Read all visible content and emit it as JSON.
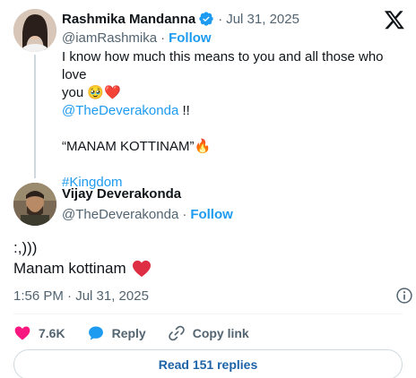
{
  "quoted_tweet": {
    "display_name": "Rashmika Mandanna",
    "handle": "@iamRashmika",
    "follow_label": "Follow",
    "date": "Jul 31, 2025",
    "separator": "·",
    "text_line1": "I know how much this means to you and all those who love",
    "text_line2": "you",
    "emoji_1": "🥹",
    "emoji_2": "❤️",
    "mention": "@TheDeverakonda",
    "mention_suffix": " !!",
    "quote_line": "“MANAM KOTTINAM”",
    "emoji_fire": "🔥",
    "hashtag": "#Kingdom"
  },
  "tweet": {
    "display_name": "Vijay Deverakonda",
    "handle": "@TheDeverakonda",
    "follow_label": "Follow",
    "separator": "·",
    "text_line1": ":,)))",
    "text_line2": "Manam kottinam",
    "timestamp": "1:56 PM · Jul 31, 2025"
  },
  "actions": {
    "like_count": "7.6K",
    "reply_label": "Reply",
    "copy_link_label": "Copy link"
  },
  "read_replies_label": "Read 151 replies",
  "colors": {
    "accent": "#1d9bf0",
    "like": "#f91880",
    "text": "#0f1419",
    "muted": "#536471"
  },
  "icons": [
    "x-logo-icon",
    "verified-badge-icon",
    "info-icon",
    "heart-icon",
    "reply-bubble-icon",
    "link-icon"
  ]
}
